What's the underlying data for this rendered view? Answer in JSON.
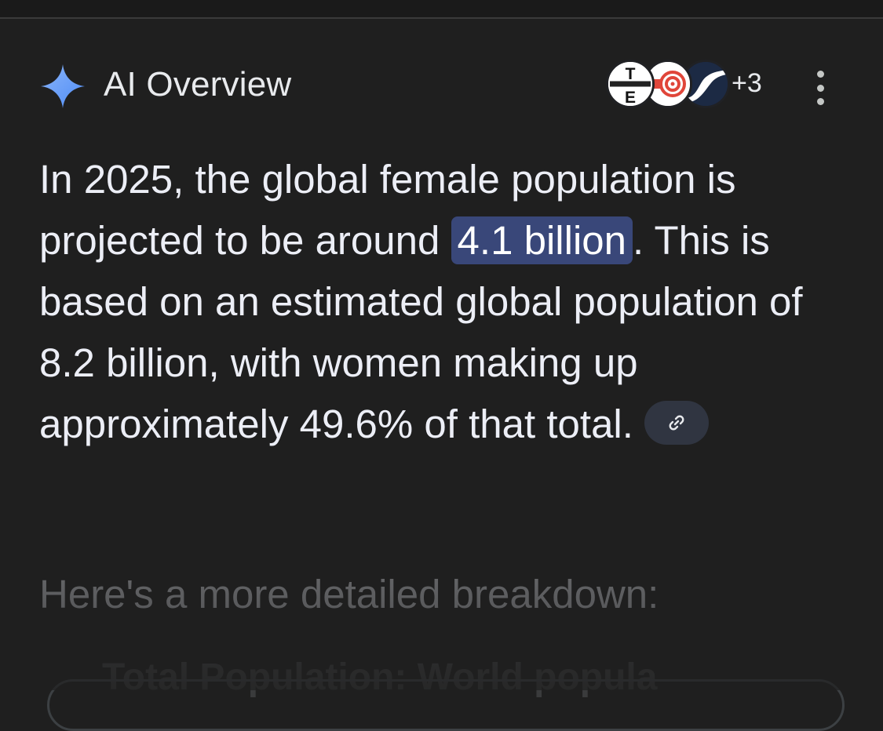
{
  "header": {
    "title": "AI Overview",
    "sources_more": "+3",
    "source_icons": [
      "te-source-icon",
      "red-spiral-source-icon",
      "blue-wave-source-icon"
    ],
    "te_letters": [
      "T",
      "E"
    ]
  },
  "answer": {
    "part1": "In 2025, the global female population is projected to be around ",
    "highlight": "4.1 billion",
    "part2": ". This is based on an estimated global population of 8.2 billion, with women making up approximately 49.6% of that total."
  },
  "breakdown_heading": "Here's a more detailed breakdown:",
  "faded_next_item": "Total Population: World popula",
  "colors": {
    "background": "#1f1f1f",
    "highlight_bg": "#394779",
    "sparkle": "#6ea1f5",
    "link_chip_bg": "#303541"
  }
}
